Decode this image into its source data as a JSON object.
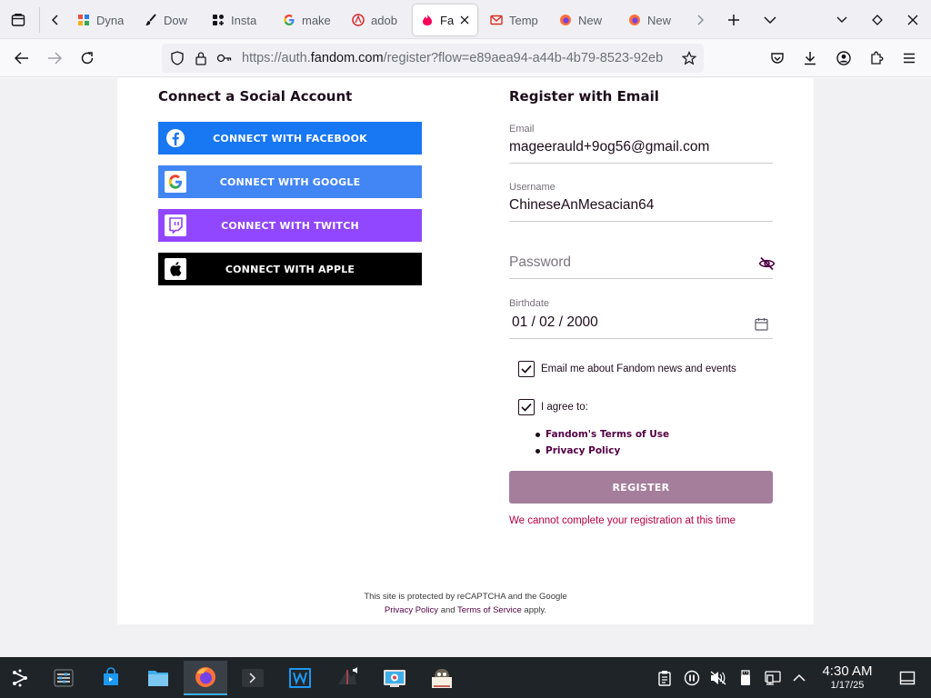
{
  "tabs": [
    {
      "title": "Dyna",
      "icon": "dynalist-icon"
    },
    {
      "title": "Dow",
      "icon": "brush-icon"
    },
    {
      "title": "Insta",
      "icon": "instagram-icon"
    },
    {
      "title": "make",
      "icon": "google-icon"
    },
    {
      "title": "adob",
      "icon": "adobe-icon"
    },
    {
      "title": "Fa",
      "icon": "fandom-icon",
      "active": true
    },
    {
      "title": "Temp",
      "icon": "gmail-icon"
    },
    {
      "title": "New",
      "icon": "firefox-icon"
    },
    {
      "title": "New",
      "icon": "firefox-icon"
    }
  ],
  "navbar": {
    "url_prefix": "https://auth.",
    "url_host": "fandom.com",
    "url_suffix": "/register?flow=e89aea94-a44b-4b79-8523-92eb"
  },
  "social": {
    "title": "Connect a Social Account",
    "buttons": [
      {
        "label": "CONNECT WITH FACEBOOK",
        "color": "#1877f2",
        "icon": "facebook-icon"
      },
      {
        "label": "CONNECT WITH GOOGLE",
        "color": "#4285f4",
        "icon": "google-icon"
      },
      {
        "label": "CONNECT WITH TWITCH",
        "color": "#9146ff",
        "icon": "twitch-icon"
      },
      {
        "label": "CONNECT WITH APPLE",
        "color": "#000000",
        "icon": "apple-icon"
      }
    ]
  },
  "register": {
    "title": "Register with Email",
    "email_label": "Email",
    "email_value": "mageerauld+9og56@gmail.com",
    "username_label": "Username",
    "username_value": "ChineseAnMesacian64",
    "password_placeholder": "Password",
    "birthdate_label": "Birthdate",
    "birthdate_value": "01 / 02 / 2000",
    "news_checkbox_label": "Email me about Fandom news and events",
    "news_checked": true,
    "agree_checkbox_label": "I agree to:",
    "agree_checked": true,
    "terms_link": "Fandom's Terms of Use",
    "privacy_link": "Privacy Policy",
    "register_button": "REGISTER",
    "error": "We cannot complete your registration at this time"
  },
  "recaptcha": {
    "line1": "This site is protected by reCAPTCHA and the Google",
    "privacy": "Privacy Policy",
    "and": "and",
    "terms": "Terms of Service",
    "apply": "apply."
  },
  "taskbar": {
    "time": "4:30 AM",
    "date": "1/17/25"
  },
  "colors": {
    "fandom_purple": "#520044",
    "error_red": "#b5003d",
    "register_disabled": "#a47e9b"
  }
}
